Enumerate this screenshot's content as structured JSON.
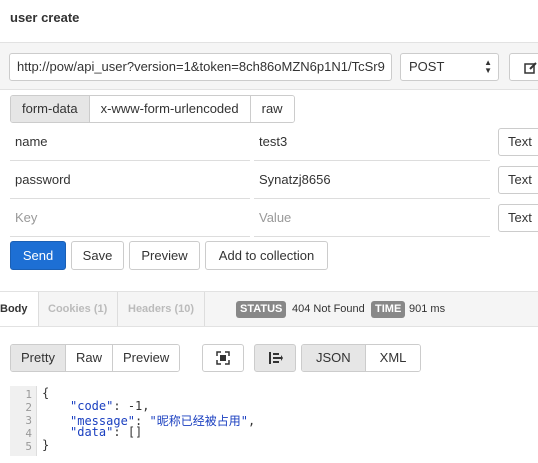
{
  "header": {
    "title": "user create"
  },
  "request": {
    "url": "http://pow/api_user?version=1&token=8ch86oMZN6p1N1/TcSr9",
    "method": "POST",
    "body_tabs": [
      {
        "label": "form-data",
        "active": true
      },
      {
        "label": "x-www-form-urlencoded",
        "active": false
      },
      {
        "label": "raw",
        "active": false
      }
    ],
    "params": [
      {
        "key": "name",
        "value": "test3",
        "type": "Text"
      },
      {
        "key": "password",
        "value": "Synatzj8656",
        "type": "Text"
      }
    ],
    "empty_row": {
      "key_placeholder": "Key",
      "value_placeholder": "Value",
      "type": "Text"
    },
    "actions": {
      "send": "Send",
      "save": "Save",
      "preview": "Preview",
      "add_to_collection": "Add to collection"
    }
  },
  "response": {
    "tabs": {
      "body": "Body",
      "cookies": "Cookies (1)",
      "headers": "Headers (10)"
    },
    "status_label": "STATUS",
    "status_value": "404 Not Found",
    "time_label": "TIME",
    "time_value": "901 ms",
    "view_modes": [
      {
        "label": "Pretty",
        "active": true
      },
      {
        "label": "Raw",
        "active": false
      },
      {
        "label": "Preview",
        "active": false
      }
    ],
    "formats": [
      {
        "label": "JSON",
        "active": true
      },
      {
        "label": "XML",
        "active": false
      }
    ],
    "code": {
      "line_numbers": [
        "1",
        "2",
        "3",
        "4",
        "5"
      ],
      "open_brace": "{",
      "close_brace": "}",
      "fields": [
        {
          "key": "\"code\"",
          "sep": ": ",
          "value": "-1",
          "trail": ","
        },
        {
          "key": "\"message\"",
          "sep": ": ",
          "value": "\"昵称已经被占用\"",
          "trail": ","
        },
        {
          "key": "\"data\"",
          "sep": ": ",
          "value": "[]",
          "trail": ""
        }
      ]
    }
  },
  "icons": {
    "edit": "edit-icon",
    "expand": "expand-icon",
    "wrap": "wrap-lines-icon",
    "method_arrows": "select-arrows-icon"
  }
}
